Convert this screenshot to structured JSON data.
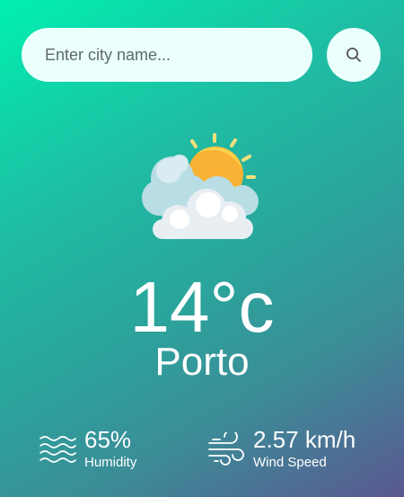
{
  "search": {
    "placeholder": "Enter city name...",
    "value": ""
  },
  "weather": {
    "temperature": "14°c",
    "city": "Porto",
    "condition_icon": "partly-cloudy-icon"
  },
  "details": {
    "humidity": {
      "value": "65%",
      "label": "Humidity",
      "icon": "humidity-icon"
    },
    "wind": {
      "value": "2.57 km/h",
      "label": "Wind Speed",
      "icon": "wind-icon"
    }
  },
  "colors": {
    "gradient_start": "#00f0b0",
    "gradient_end": "#5a5890",
    "input_background": "#ebfffc",
    "sun": "#f9b233",
    "cloud": "#e8eef2"
  }
}
